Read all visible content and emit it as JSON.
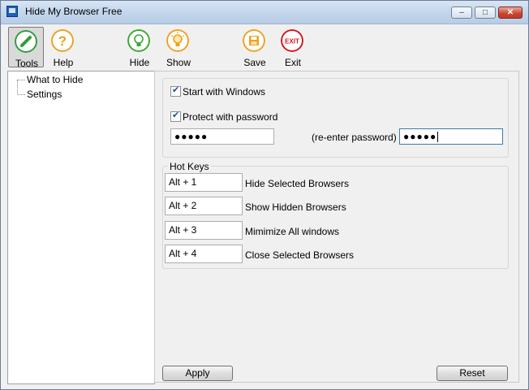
{
  "window": {
    "title": "Hide My Browser Free",
    "controls": {
      "minimize": "–",
      "maximize": "□",
      "close": "✕"
    }
  },
  "toolbar": {
    "items": [
      {
        "label": "Tools",
        "icon": "pencil-icon",
        "color": "#2e9b3e",
        "active": true
      },
      {
        "label": "Help",
        "icon": "question-icon",
        "color": "#e8a21c"
      },
      {
        "label": "Hide",
        "icon": "bulb-off-icon",
        "color": "#3aa832"
      },
      {
        "label": "Show",
        "icon": "bulb-on-icon",
        "color": "#f0a020"
      },
      {
        "label": "Save",
        "icon": "save-icon",
        "color": "#f0a020"
      },
      {
        "label": "Exit",
        "icon": "exit-icon",
        "color": "#d8141e",
        "icon_text": "EXIT"
      }
    ]
  },
  "tree": {
    "items": [
      {
        "label": "What to Hide"
      },
      {
        "label": "Settings"
      }
    ]
  },
  "settings": {
    "start_with_windows": {
      "label": "Start with Windows",
      "checked": true
    },
    "protect_with_password": {
      "label": "Protect with password",
      "checked": true
    },
    "password": "●●●●●",
    "reenter_label": "(re-enter password)",
    "reenter_password": "●●●●●"
  },
  "hotkeys": {
    "group_label": "Hot Keys",
    "rows": [
      {
        "key": "Alt + 1",
        "action": "Hide Selected Browsers"
      },
      {
        "key": "Alt + 2",
        "action": "Show Hidden Browsers"
      },
      {
        "key": "Alt + 3",
        "action": "Mimimize All windows"
      },
      {
        "key": "Alt + 4",
        "action": "Close Selected Browsers"
      }
    ]
  },
  "buttons": {
    "apply": "Apply",
    "reset": "Reset"
  }
}
